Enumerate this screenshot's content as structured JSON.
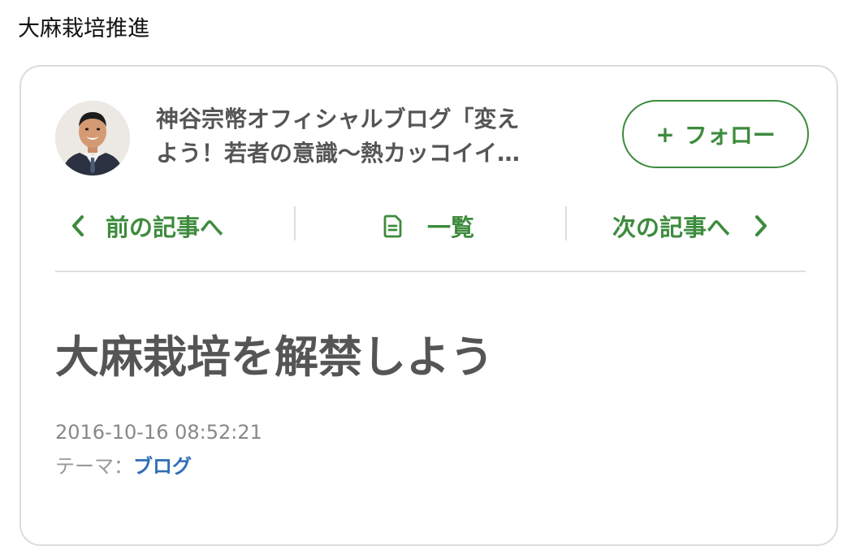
{
  "caption": "大麻栽培推進",
  "header": {
    "blog_title_line1": "神谷宗幣オフィシャルブログ「変え",
    "blog_title_line2": "よう！若者の意識〜熱カッコイイ…",
    "follow_plus": "+",
    "follow_label": "フォロー"
  },
  "nav": {
    "prev_icon": "‹",
    "prev_label": "前の記事へ",
    "list_icon": "document-icon",
    "list_label": "一覧",
    "next_label": "次の記事へ",
    "next_icon": "›"
  },
  "article": {
    "title": "大麻栽培を解禁しよう",
    "date": "2016-10-16 08:52:21",
    "theme_label": "テーマ：",
    "theme_value": "ブログ"
  },
  "colors": {
    "accent_green": "#3d8b3d",
    "link_blue": "#2f6fb5",
    "text_gray": "#555555"
  }
}
